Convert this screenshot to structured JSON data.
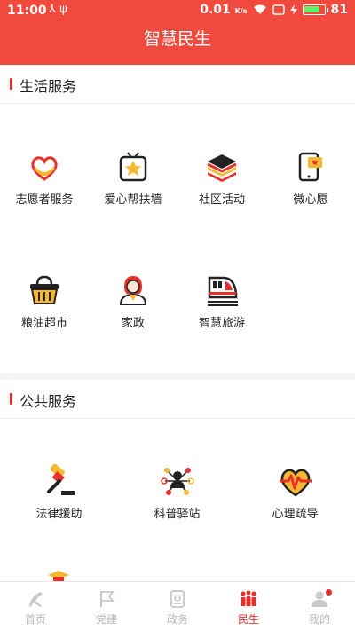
{
  "status": {
    "time": "11:00",
    "speed": "0.01",
    "speed_unit": "K/s",
    "battery": "81",
    "battery_level": 0.81
  },
  "app": {
    "title": "智慧民生"
  },
  "sections": {
    "life": {
      "title": "生活服务",
      "items": [
        {
          "label": "志愿者服务",
          "icon": "heart-hands-icon"
        },
        {
          "label": "爱心帮扶墙",
          "icon": "star-tv-icon"
        },
        {
          "label": "社区活动",
          "icon": "layers-icon"
        },
        {
          "label": "微心愿",
          "icon": "phone-heart-icon"
        },
        {
          "label": "粮油超市",
          "icon": "basket-icon"
        },
        {
          "label": "家政",
          "icon": "housekeeper-icon"
        },
        {
          "label": "智慧旅游",
          "icon": "train-icon"
        }
      ]
    },
    "public": {
      "title": "公共服务",
      "items": [
        {
          "label": "法律援助",
          "icon": "gavel-icon"
        },
        {
          "label": "科普驿站",
          "icon": "network-icon"
        },
        {
          "label": "心理疏导",
          "icon": "heartbeat-icon"
        }
      ]
    }
  },
  "tabs": [
    {
      "label": "首页",
      "icon": "party-emblem-icon"
    },
    {
      "label": "党建",
      "icon": "flag-icon"
    },
    {
      "label": "政务",
      "icon": "document-icon"
    },
    {
      "label": "民生",
      "icon": "people-icon",
      "active": true
    },
    {
      "label": "我的",
      "icon": "user-icon"
    }
  ],
  "colors": {
    "primary": "#f04a3e",
    "accent": "#e8302a",
    "icon_yellow": "#f5b830",
    "tab_inactive": "#b8b8b8"
  }
}
